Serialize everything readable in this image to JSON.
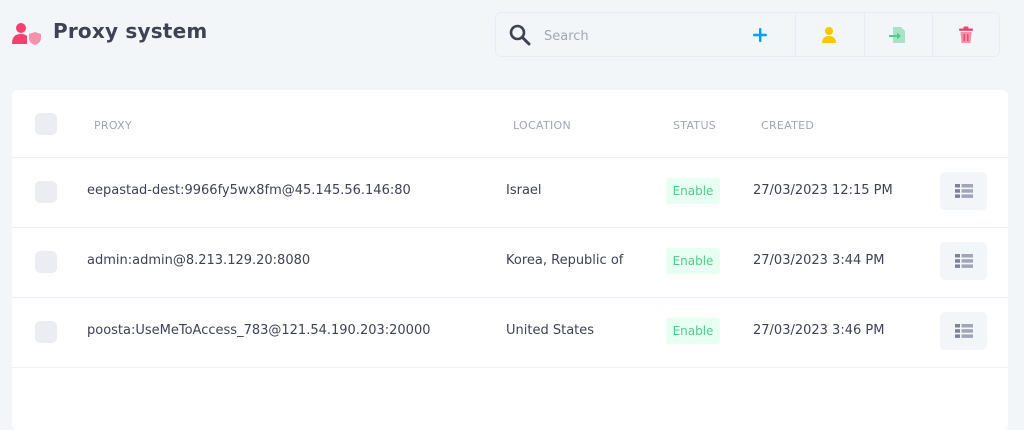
{
  "header": {
    "title": "Proxy system",
    "icon": "user-shield-icon"
  },
  "toolbar": {
    "search_placeholder": "Search",
    "search_value": "",
    "buttons": [
      {
        "name": "add-button",
        "icon": "plus-icon",
        "color": "#009ef7"
      },
      {
        "name": "user-button",
        "icon": "user-icon",
        "color": "#ffc700"
      },
      {
        "name": "import-button",
        "icon": "file-import-icon",
        "color": "#50cd89"
      },
      {
        "name": "delete-button",
        "icon": "trash-icon",
        "color": "#f1416c"
      }
    ]
  },
  "table": {
    "columns": [
      "PROXY",
      "LOCATION",
      "STATUS",
      "CREATED"
    ],
    "rows": [
      {
        "proxy": "eepastad-dest:9966fy5wx8fm@45.145.56.146:80",
        "location": "Israel",
        "status": "Enable",
        "created": "27/03/2023 12:15 PM"
      },
      {
        "proxy": "admin:admin@8.213.129.20:8080",
        "location": "Korea, Republic of",
        "status": "Enable",
        "created": "27/03/2023 3:44 PM"
      },
      {
        "proxy": "poosta:UseMeToAccess_783@121.54.190.203:20000",
        "location": "United States",
        "status": "Enable",
        "created": "27/03/2023 3:46 PM"
      }
    ]
  },
  "colors": {
    "accent": "#009ef7",
    "brand_icon": "#f1416c",
    "status_enable_bg": "#e8fff3",
    "status_enable_text": "#50cd89"
  }
}
